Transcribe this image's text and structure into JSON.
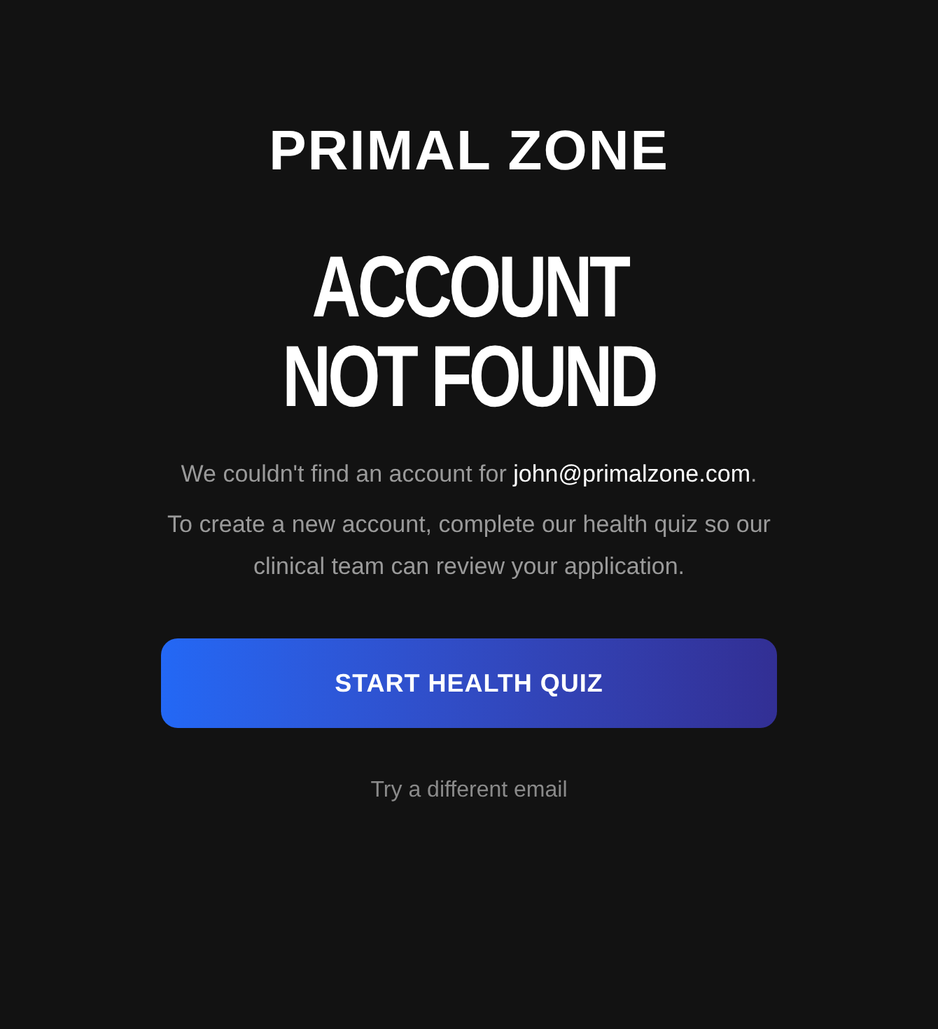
{
  "logo": "PRIMAL ZONE",
  "title_lines": [
    "ACCOUNT",
    "NOT FOUND"
  ],
  "message": {
    "before": "We couldn't find an account for",
    "email": "john@primalzone.com",
    "after": "."
  },
  "explanation": "To create a new account, complete our health quiz so our clinical team can review your application.",
  "primary_button": "START HEALTH QUIZ",
  "secondary_link": "Try a different email"
}
